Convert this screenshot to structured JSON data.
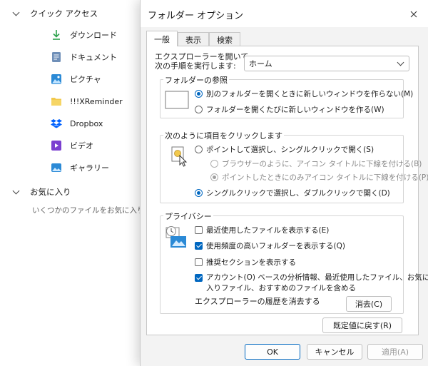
{
  "explorer": {
    "quick_access": {
      "label": "クイック アクセス"
    },
    "items": [
      {
        "label": "ダウンロード",
        "icon": "download-icon"
      },
      {
        "label": "ドキュメント",
        "icon": "document-icon"
      },
      {
        "label": "ピクチャ",
        "icon": "pictures-icon"
      },
      {
        "label": "!!!XReminder",
        "icon": "folder-icon"
      },
      {
        "label": "Dropbox",
        "icon": "dropbox-icon"
      },
      {
        "label": "ビデオ",
        "icon": "video-icon"
      },
      {
        "label": "ギャラリー",
        "icon": "gallery-icon"
      }
    ],
    "favorites": {
      "label": "お気に入り",
      "hint": "いくつかのファイルをお気に入りに追加"
    }
  },
  "dialog": {
    "title": "フォルダー オプション",
    "tabs": [
      "一般",
      "表示",
      "検索"
    ],
    "active_tab": "一般",
    "open_explorer": {
      "label_line1": "エクスプローラーを開いて、",
      "label_line2": "次の手順を実行します:",
      "selected": "ホーム"
    },
    "browse": {
      "title": "フォルダーの参照",
      "options": [
        {
          "label": "別のフォルダーを開くときに新しいウィンドウを作らない(M)",
          "selected": true
        },
        {
          "label": "フォルダーを開くたびに新しいウィンドウを作る(W)",
          "selected": false
        }
      ]
    },
    "click": {
      "title": "次のように項目をクリックします",
      "options": [
        {
          "label": "ポイントして選択し、シングルクリックで開く(S)",
          "selected": false,
          "enabled": true
        },
        {
          "label": "ブラウザーのように、アイコン タイトルに下線を付ける(B)",
          "selected": false,
          "enabled": false
        },
        {
          "label": "ポイントしたときにのみアイコン タイトルに下線を付ける(P)",
          "selected": true,
          "enabled": false
        },
        {
          "label": "シングルクリックで選択し、ダブルクリックで開く(D)",
          "selected": true,
          "enabled": true
        }
      ]
    },
    "privacy": {
      "title": "プライバシー",
      "checks": [
        {
          "label": "最近使用したファイルを表示する(E)",
          "checked": false
        },
        {
          "label": "使用頻度の高いフォルダーを表示する(Q)",
          "checked": true
        },
        {
          "label": "推奨セクションを表示する",
          "checked": false
        },
        {
          "label_line1": "アカウント(O) ベースの分析情報、最近使用したファイル、お気に",
          "label_line2": "入りファイル、おすすめのファイルを含める",
          "checked": true
        }
      ],
      "clear_history_label": "エクスプローラーの履歴を消去する",
      "clear_button": "消去(C)"
    },
    "restore_defaults": "既定値に戻す(R)",
    "ok": "OK",
    "cancel": "キャンセル",
    "apply": "適用(A)"
  },
  "colors": {
    "accent": "#0067c0",
    "dialog_bg": "#f3f3f3"
  }
}
